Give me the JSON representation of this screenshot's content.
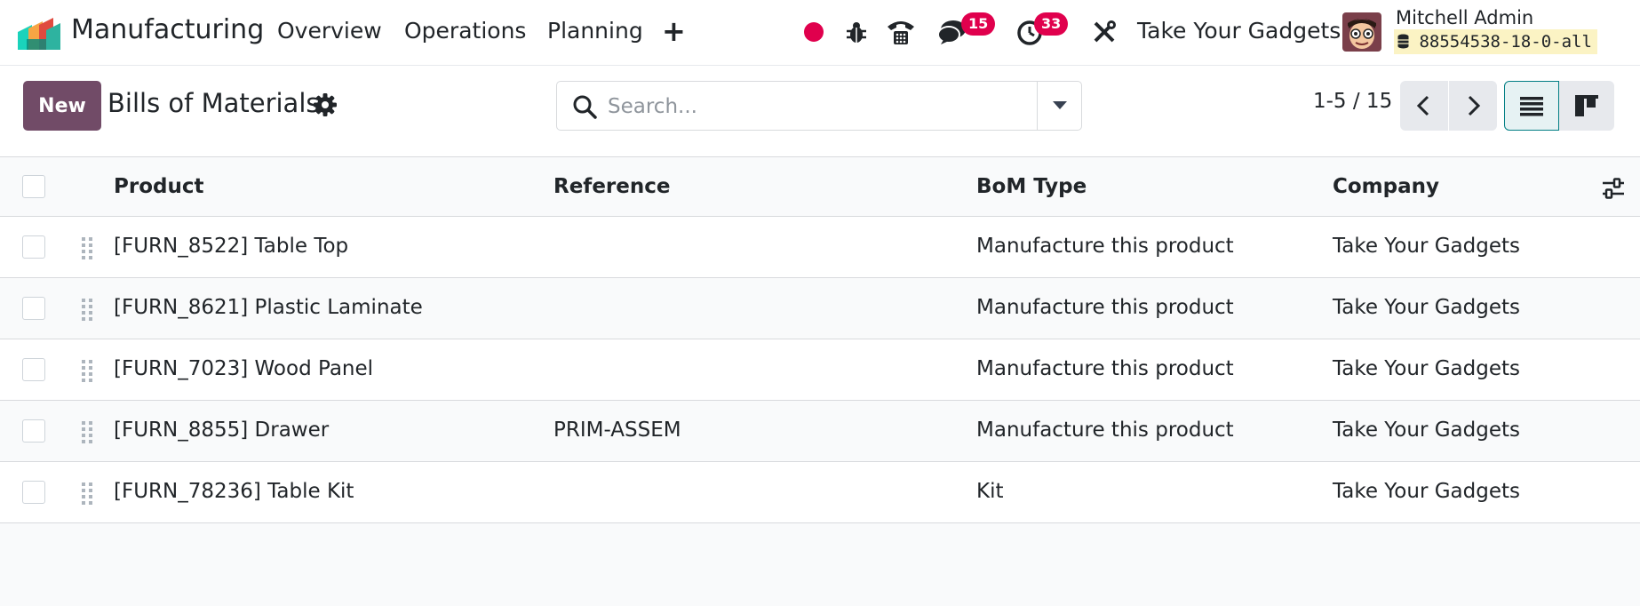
{
  "navbar": {
    "app_name": "Manufacturing",
    "menu": [
      "Overview",
      "Operations",
      "Planning"
    ],
    "plus_label": "+",
    "messages_count": "15",
    "activities_count": "33",
    "company": "Take Your Gadgets",
    "user_name": "Mitchell Admin",
    "database": "88554538-18-0-all",
    "icons": [
      "recording-dot-icon",
      "bug-icon",
      "phone-icon",
      "chat-icon",
      "clock-icon",
      "tools-icon"
    ],
    "recording_color": "#e0004d"
  },
  "control_panel": {
    "new_label": "New",
    "title": "Bills of Materials",
    "search": {
      "placeholder": "Search...",
      "value": ""
    },
    "pager": "1-5 / 15",
    "accent_color": "#714b67"
  },
  "list": {
    "columns": [
      "Product",
      "Reference",
      "BoM Type",
      "Company"
    ],
    "rows": [
      {
        "product": "[FURN_8522] Table Top",
        "reference": "",
        "bom_type": "Manufacture this product",
        "company": "Take Your Gadgets"
      },
      {
        "product": "[FURN_8621] Plastic Laminate",
        "reference": "",
        "bom_type": "Manufacture this product",
        "company": "Take Your Gadgets"
      },
      {
        "product": "[FURN_7023] Wood Panel",
        "reference": "",
        "bom_type": "Manufacture this product",
        "company": "Take Your Gadgets"
      },
      {
        "product": "[FURN_8855] Drawer",
        "reference": "PRIM-ASSEM",
        "bom_type": "Manufacture this product",
        "company": "Take Your Gadgets"
      },
      {
        "product": "[FURN_78236] Table Kit",
        "reference": "",
        "bom_type": "Kit",
        "company": "Take Your Gadgets"
      }
    ]
  }
}
